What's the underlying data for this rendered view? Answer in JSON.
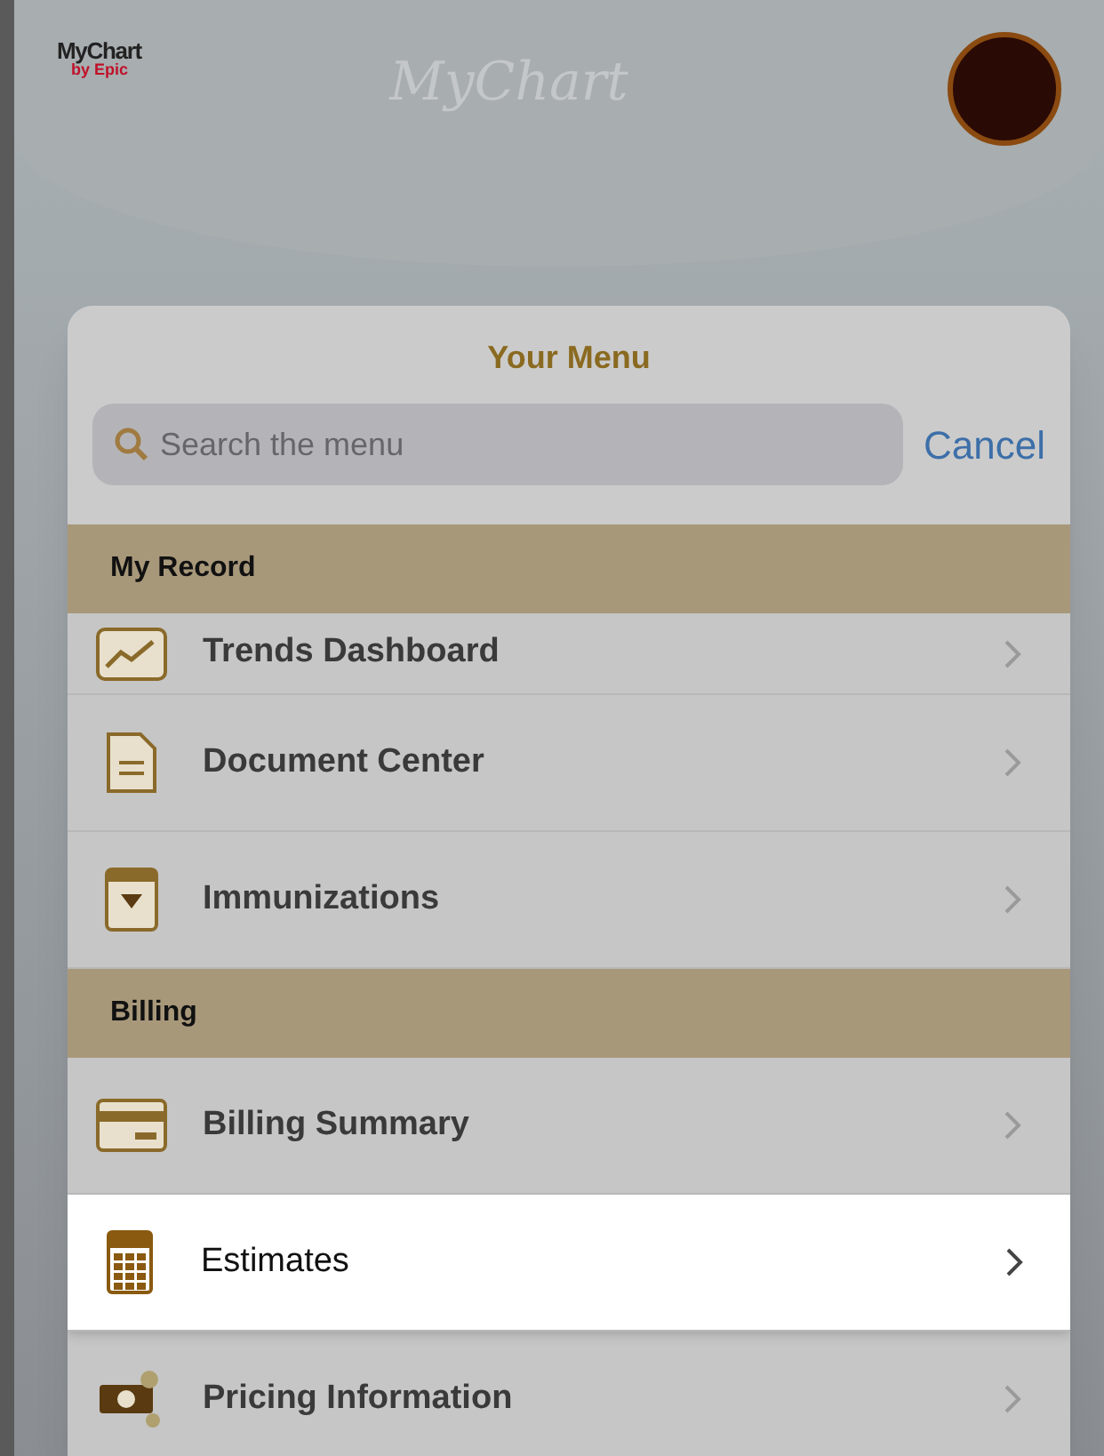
{
  "header": {
    "logo_line_1": "MyChart",
    "logo_line_2": "by Epic",
    "title": "MyChart"
  },
  "menu": {
    "title": "Your Menu",
    "search": {
      "placeholder": "Search the menu"
    },
    "cancel": "Cancel",
    "sections": [
      {
        "title": "My Record",
        "items": [
          {
            "label": "Trends Dashboard",
            "kind": "chart",
            "selected": false
          },
          {
            "label": "Document Center",
            "kind": "document",
            "selected": false
          },
          {
            "label": "Immunizations",
            "kind": "vaccine",
            "selected": false
          }
        ]
      },
      {
        "title": "Billing",
        "items": [
          {
            "label": "Billing Summary",
            "kind": "card",
            "selected": false
          },
          {
            "label": "Estimates",
            "kind": "calculator",
            "selected": true
          },
          {
            "label": "Pricing Information",
            "kind": "money",
            "selected": false
          }
        ]
      }
    ]
  }
}
